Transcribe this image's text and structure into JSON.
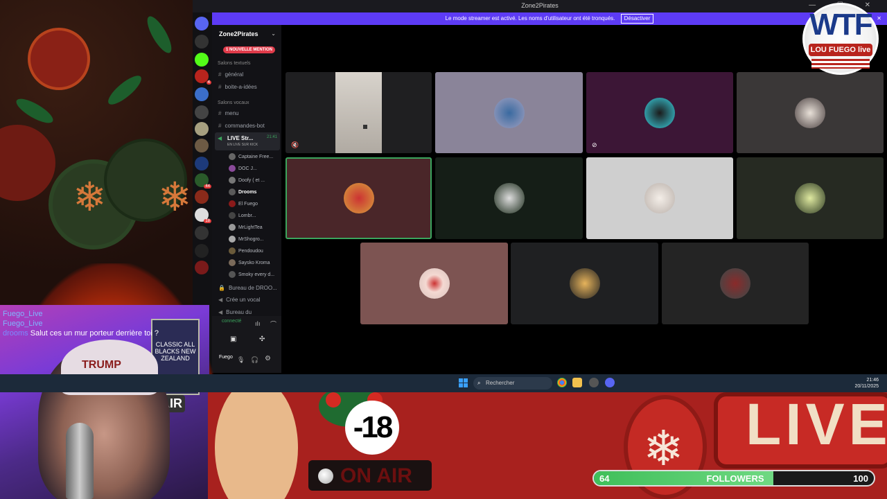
{
  "window": {
    "title": "Zone2Pirates"
  },
  "streamer_bar": {
    "text": "Le mode streamer est activé. Les noms d'utilisateur ont été tronqués.",
    "button": "Désactiver"
  },
  "server": {
    "name": "Zone2Pirates",
    "mention_badge": "1 NOUVELLE MENTION"
  },
  "channels": {
    "text_category": "Salons textuels",
    "text_channels": [
      "général",
      "boite-a-idées"
    ],
    "voice_category": "Salons vocaux",
    "voice_channels": [
      "menu",
      "commandes-bot"
    ],
    "live_channel": {
      "name": "LIVE Str...",
      "time": "21:41",
      "sub": "EN LIVE SUR KICK"
    },
    "members": [
      "Captaine Free...",
      "DOC J...",
      "Doofy ( et ...",
      "Drooms",
      "El Fuego",
      "Lombr...",
      "MrLightTea",
      "MrShogro...",
      "Pendoudou",
      "Saysko Kroma",
      "Smoky every d..."
    ],
    "bureau": "Bureau de DROO...",
    "create_vocal": "Crée un vocal",
    "bureau2": "Bureau du",
    "connected": "connecté",
    "user": "Fuego"
  },
  "chat": [
    {
      "user": "Fuego_Live",
      "msg": ""
    },
    {
      "user": "Fuego_Live",
      "msg": ""
    },
    {
      "user": "drooms",
      "msg": "Salut ces un mur porteur derrière toi ?"
    }
  ],
  "cam": {
    "cap_text": "TRUMP",
    "sign_text": "CLASSIC ALL BLACKS NEW ZEALAND",
    "air_text": "AIR"
  },
  "taskbar": {
    "search_placeholder": "Rechercher",
    "time": "21:46",
    "date": "20/11/2025"
  },
  "overlay": {
    "age_badge": "-18",
    "on_air": "ON AIR",
    "live_text": "LIVE",
    "followers": {
      "current": "64",
      "label": "FOLLOWERS",
      "goal": "100",
      "progress": 0.64
    },
    "logo": {
      "main": "WTF",
      "sub": "LOU FUEGO live"
    }
  },
  "colors": {
    "accent": "#5d3bf5",
    "live_green": "#3ba55d",
    "mention_red": "#e03b4a"
  }
}
